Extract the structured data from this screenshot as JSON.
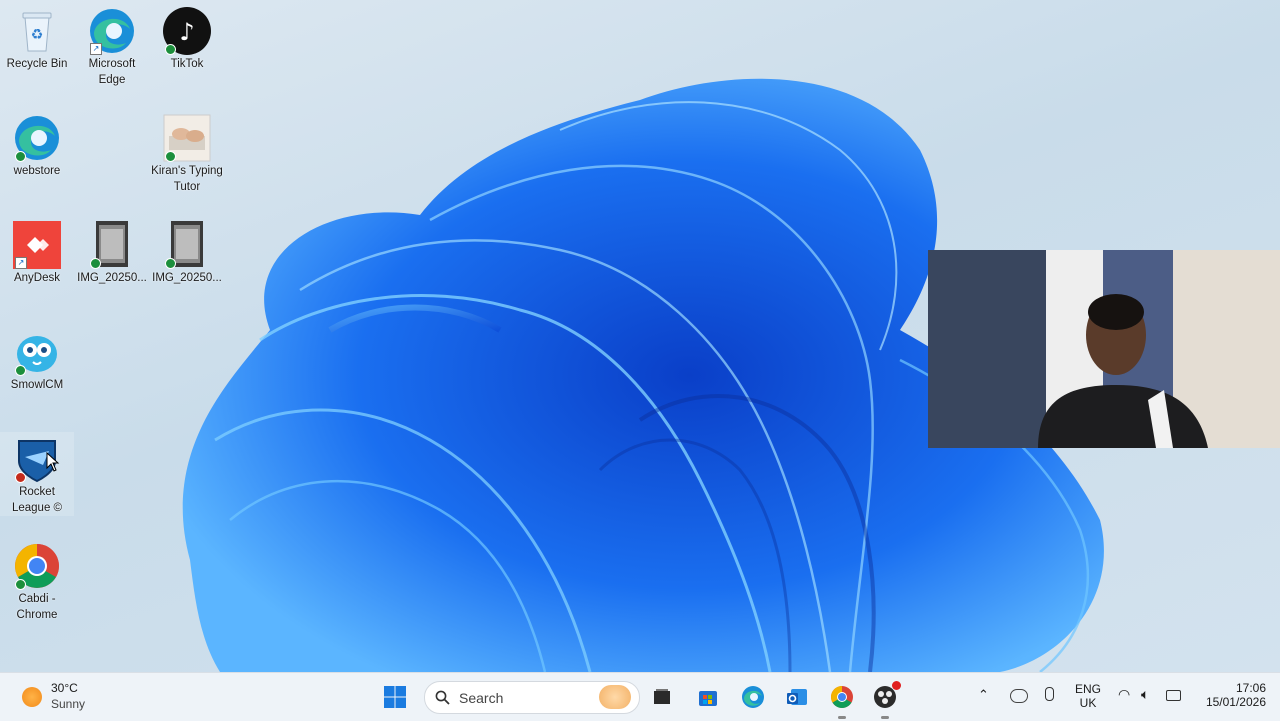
{
  "desktop": {
    "icons": [
      {
        "label": "Recycle Bin",
        "icon": "recycle-bin-icon"
      },
      {
        "label": "Microsoft Edge",
        "icon": "edge-icon"
      },
      {
        "label": "TikTok",
        "icon": "tiktok-icon"
      },
      {
        "label": "webstore",
        "icon": "edge-icon"
      },
      {
        "label": "Kiran's Typing Tutor",
        "icon": "typing-tutor-icon"
      },
      {
        "label": "AnyDesk",
        "icon": "anydesk-icon"
      },
      {
        "label": "IMG_20250...",
        "icon": "image-file-icon"
      },
      {
        "label": "IMG_20250...",
        "icon": "image-file-icon"
      },
      {
        "label": "SmowlCM",
        "icon": "smowl-icon"
      },
      {
        "label": "Rocket League ©",
        "icon": "rocket-league-icon"
      },
      {
        "label": "Cabdi - Chrome",
        "icon": "chrome-icon"
      }
    ]
  },
  "taskbar": {
    "weather": {
      "temperature": "30°C",
      "condition": "Sunny"
    },
    "search": {
      "placeholder": "Search"
    },
    "tray": {
      "language": "ENG",
      "region": "UK",
      "time": "17:06",
      "date": "15/01/2026"
    }
  },
  "colors": {
    "accent": "#1a73e8",
    "taskbar_bg": "#eef3f8",
    "bloom": "#1f6fe8"
  }
}
